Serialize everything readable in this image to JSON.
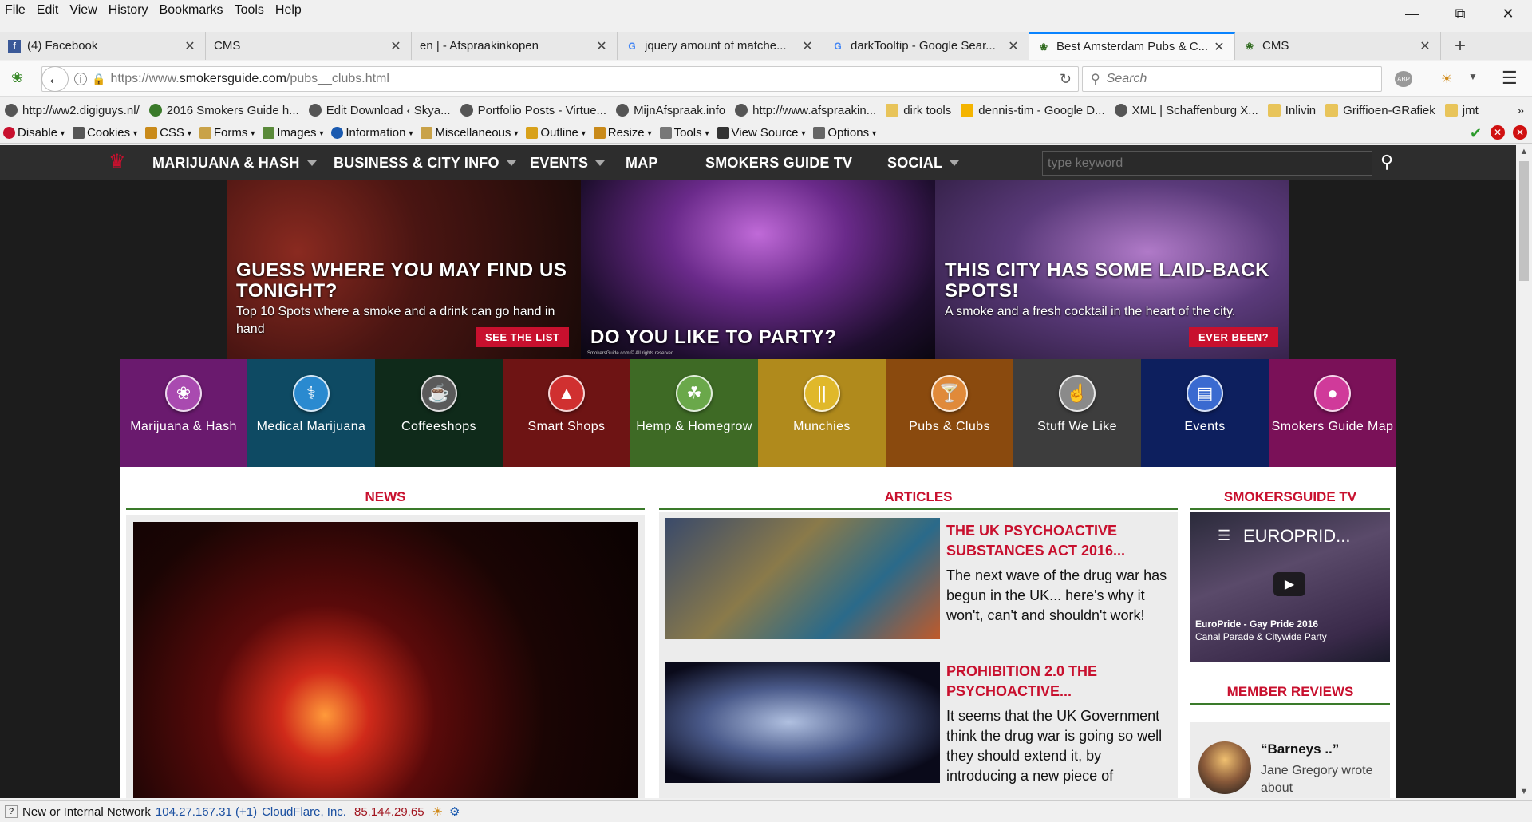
{
  "menubar": {
    "items": [
      "File",
      "Edit",
      "View",
      "History",
      "Bookmarks",
      "Tools",
      "Help"
    ]
  },
  "tabs": [
    {
      "title": "(4) Facebook",
      "icon": "facebook-icon"
    },
    {
      "title": "CMS",
      "icon": ""
    },
    {
      "title": "en | - Afspraakinkopen",
      "icon": ""
    },
    {
      "title": "jquery amount of matche...",
      "icon": "google-icon"
    },
    {
      "title": "darkTooltip - Google Sear...",
      "icon": "google-icon"
    },
    {
      "title": "Best Amsterdam Pubs & C...",
      "icon": "leaf-icon",
      "active": true
    },
    {
      "title": "CMS",
      "icon": "leaf-icon"
    }
  ],
  "navbar": {
    "url_prefix": "https://www.",
    "url_domain": "smokersguide.com",
    "url_path": "/pubs__clubs.html",
    "search_placeholder": "Search"
  },
  "bookmarks": [
    {
      "label": "http://ww2.digiguys.nl/",
      "icon": "globe"
    },
    {
      "label": "2016 Smokers Guide h...",
      "icon": "leaf"
    },
    {
      "label": "Edit Download ‹ Skya...",
      "icon": "globe"
    },
    {
      "label": "Portfolio Posts - Virtue...",
      "icon": "globe"
    },
    {
      "label": "MijnAfspraak.info",
      "icon": "globe"
    },
    {
      "label": "http://www.afspraakin...",
      "icon": "globe"
    },
    {
      "label": "dirk tools",
      "icon": "folder"
    },
    {
      "label": "dennis-tim - Google D...",
      "icon": "drive"
    },
    {
      "label": "XML | Schaffenburg X...",
      "icon": "globe"
    },
    {
      "label": "Inlivin",
      "icon": "folder"
    },
    {
      "label": "Griffioen-GRafiek",
      "icon": "folder"
    },
    {
      "label": "jmt",
      "icon": "folder"
    }
  ],
  "webdev": [
    "Disable",
    "Cookies",
    "CSS",
    "Forms",
    "Images",
    "Information",
    "Miscellaneous",
    "Outline",
    "Resize",
    "Tools",
    "View Source",
    "Options"
  ],
  "site": {
    "nav": [
      "MARIJUANA & HASH",
      "BUSINESS & CITY INFO",
      "EVENTS",
      "MAP",
      "SMOKERS GUIDE TV",
      "SOCIAL"
    ],
    "search_placeholder": "type keyword",
    "hero": [
      {
        "title": "GUESS WHERE YOU MAY FIND US TONIGHT?",
        "text": "Top 10 Spots where a smoke and a drink can go hand in hand",
        "button": "SEE THE LIST"
      },
      {
        "title": "DO YOU LIKE TO PARTY?",
        "text": "",
        "button": "",
        "credit": "SmokersGuide.com © All rights reserved"
      },
      {
        "title": "THIS CITY HAS SOME LAID-BACK SPOTS!",
        "text": "A smoke and a fresh cocktail in the heart of the city.",
        "button": "EVER BEEN?"
      }
    ],
    "categories": [
      {
        "label": "Marijuana & Hash",
        "color": "#6a1a6e",
        "icon": "cannabis-leaf-icon"
      },
      {
        "label": "Medical Marijuana",
        "color": "#0e4a63",
        "icon": "medical-caduceus-icon"
      },
      {
        "label": "Coffeeshops",
        "color": "#0f2a1a",
        "icon": "coffeeshop-icon"
      },
      {
        "label": "Smart Shops",
        "color": "#6e1414",
        "icon": "mushroom-icon"
      },
      {
        "label": "Hemp & Homegrow",
        "color": "#3e6a25",
        "icon": "hemp-plant-icon"
      },
      {
        "label": "Munchies",
        "color": "#b08a1c",
        "icon": "fork-knife-icon"
      },
      {
        "label": "Pubs & Clubs",
        "color": "#8a4a0e",
        "icon": "cocktail-icon"
      },
      {
        "label": "Stuff We Like",
        "color": "#3d3d3d",
        "icon": "thumbs-up-icon"
      },
      {
        "label": "Events",
        "color": "#0d1f5e",
        "icon": "calendar-icon"
      },
      {
        "label": "Smokers Guide Map",
        "color": "#7a1158",
        "icon": "map-pin-icon"
      }
    ],
    "sections": {
      "news": "NEWS",
      "articles": "ARTICLES",
      "tv": "SMOKERSGUIDE TV",
      "reviews": "MEMBER REVIEWS"
    },
    "articles": [
      {
        "title": "THE UK PSYCHOACTIVE SUBSTANCES ACT 2016...",
        "text": "The next wave of the drug war has begun in the UK... here's why it won't, can't and shouldn't work!"
      },
      {
        "title": "PROHIBITION 2.0 THE PSYCHOACTIVE...",
        "text": "It seems that the UK Government think the drug war is going so well they should extend it, by introducing a new piece of"
      }
    ],
    "video": {
      "title": "EUROPRID...",
      "caption1": "EuroPride - Gay Pride 2016",
      "caption2": "Canal Parade & Citywide Party"
    },
    "review": {
      "title": "“Barneys ..”",
      "author": "Jane Gregory wrote",
      "more": "about"
    }
  },
  "statusbar": {
    "network": "New or Internal Network",
    "ip": "104.27.167.31 (+1)",
    "host": "CloudFlare, Inc.",
    "ip2": "85.144.29.65"
  }
}
